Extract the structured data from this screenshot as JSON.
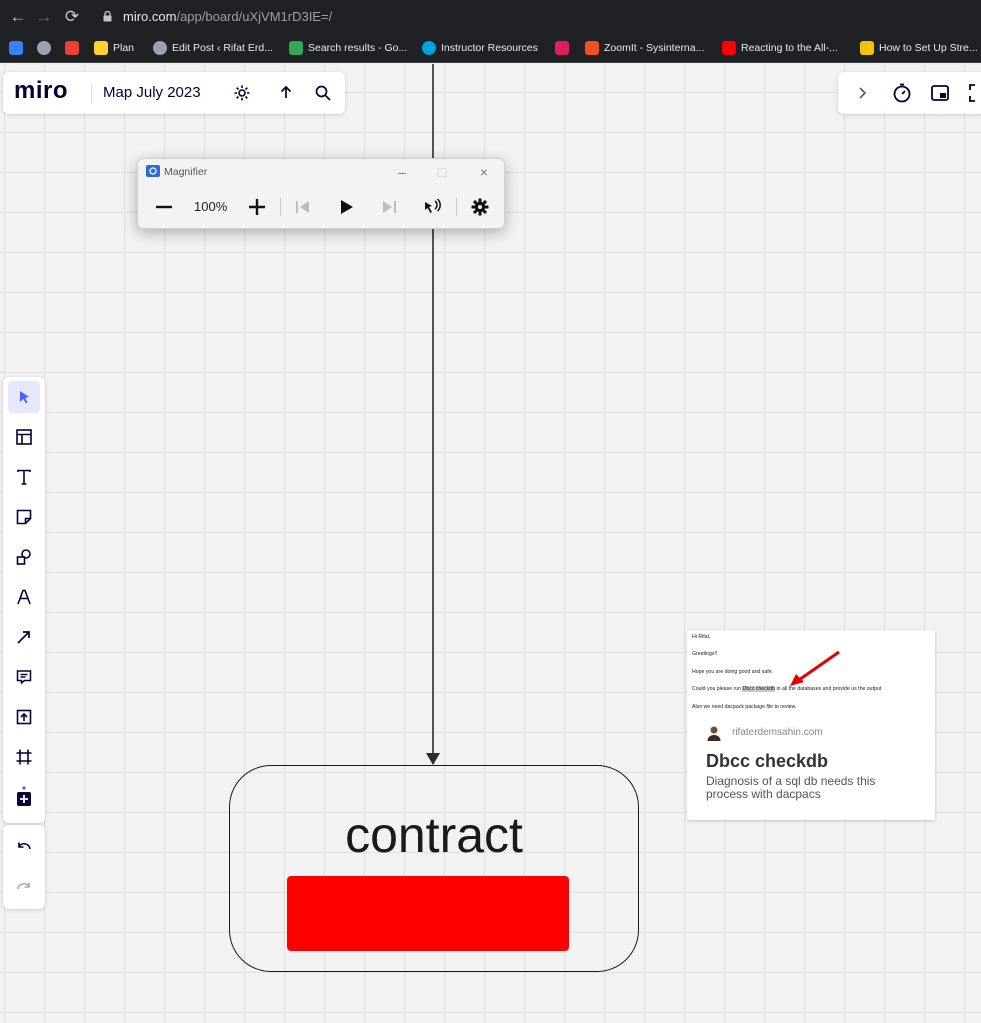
{
  "browser": {
    "url_host": "miro.com",
    "url_path": "/app/board/uXjVM1rD3IE=/",
    "bookmarks": [
      {
        "label": "",
        "icon": "app-icon",
        "color": "#3b82f6"
      },
      {
        "label": "",
        "icon": "wordpress-icon",
        "color": "#9ca3af"
      },
      {
        "label": "",
        "icon": "gmail-icon",
        "color": "#ea4335"
      },
      {
        "label": "Plan",
        "icon": "miro-icon",
        "color": "#ffd02f"
      },
      {
        "label": "Edit Post ‹ Rifat Erd...",
        "icon": "wordpress-icon",
        "color": "#9ca3af"
      },
      {
        "label": "Search results - Go...",
        "icon": "google-drive-icon",
        "color": "#34a853"
      },
      {
        "label": "Instructor Resources",
        "icon": "salesforce-icon",
        "color": "#00a1e0"
      },
      {
        "label": "",
        "icon": "slack-icon",
        "color": "#e01e5a"
      },
      {
        "label": "ZoomIt - Sysinterna...",
        "icon": "microsoft-icon",
        "color": "#f25022"
      },
      {
        "label": "Reacting to the All-...",
        "icon": "youtube-icon",
        "color": "#ff0000"
      },
      {
        "label": "How to Set Up Stre...",
        "icon": "bookmark-icon",
        "color": "#f4c20d"
      }
    ]
  },
  "header": {
    "logo": "miro",
    "board_name": "Map July 2023"
  },
  "magnifier": {
    "title": "Magnifier",
    "zoom": "100%"
  },
  "toolbar": {
    "tools": [
      "select",
      "templates",
      "text",
      "sticky-note",
      "shapes",
      "pen",
      "connection-line",
      "comment",
      "upload",
      "frame",
      "more"
    ]
  },
  "canvas": {
    "shape_label": "contract",
    "shape_fill": "#ff0000"
  },
  "card": {
    "screenshot_lines": [
      "Hi Rifat,",
      "Greetings!!",
      "Hope you are doing good and safe.",
      "Could you please run",
      "Dbcc checkdb",
      "in all the databases and provide us the output",
      "Also we need dacpack package file to review."
    ],
    "domain": "rifaterdemsahin.com",
    "title": "Dbcc checkdb",
    "description": "Diagnosis of a sql db needs this process with dacpacs"
  }
}
